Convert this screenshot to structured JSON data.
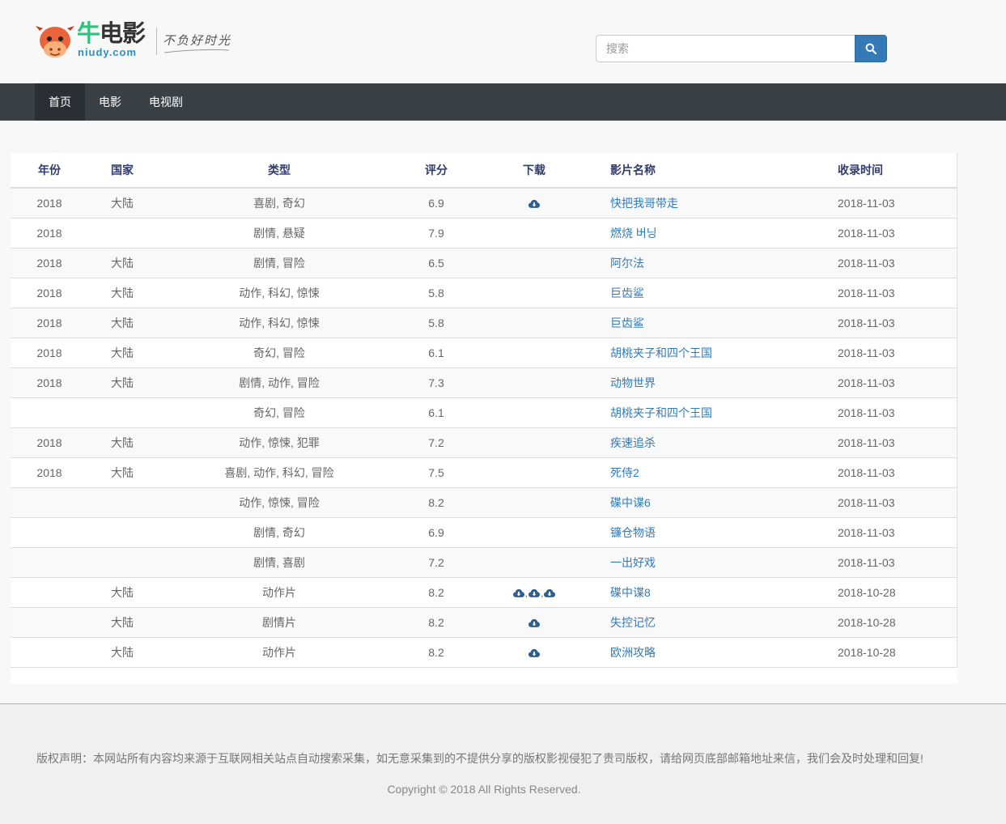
{
  "brand": {
    "name_part1": "牛",
    "name_part2": "电影",
    "domain": "niudy.com",
    "slogan": "不负好时光"
  },
  "search": {
    "placeholder": "搜索",
    "button_icon": "search-icon"
  },
  "nav": {
    "items": [
      {
        "label": "首页",
        "active": true
      },
      {
        "label": "电影",
        "active": false
      },
      {
        "label": "电视剧",
        "active": false
      }
    ]
  },
  "table": {
    "headers": {
      "year": "年份",
      "country": "国家",
      "type": "类型",
      "score": "评分",
      "download": "下载",
      "name": "影片名称",
      "date": "收录时间"
    },
    "rows": [
      {
        "year": "2018",
        "country": "大陆",
        "type": "喜剧, 奇幻",
        "score": "6.9",
        "downloads": 1,
        "name": "快把我哥带走",
        "date": "2018-11-03"
      },
      {
        "year": "2018",
        "country": "",
        "type": "剧情, 悬疑",
        "score": "7.9",
        "downloads": 0,
        "name": "燃烧 버닝",
        "date": "2018-11-03"
      },
      {
        "year": "2018",
        "country": "大陆",
        "type": "剧情, 冒险",
        "score": "6.5",
        "downloads": 0,
        "name": "阿尔法",
        "date": "2018-11-03"
      },
      {
        "year": "2018",
        "country": "大陆",
        "type": "动作, 科幻, 惊悚",
        "score": "5.8",
        "downloads": 0,
        "name": "巨齿鲨",
        "date": "2018-11-03"
      },
      {
        "year": "2018",
        "country": "大陆",
        "type": "动作, 科幻, 惊悚",
        "score": "5.8",
        "downloads": 0,
        "name": "巨齿鲨",
        "date": "2018-11-03"
      },
      {
        "year": "2018",
        "country": "大陆",
        "type": "奇幻, 冒险",
        "score": "6.1",
        "downloads": 0,
        "name": "胡桃夹子和四个王国",
        "date": "2018-11-03"
      },
      {
        "year": "2018",
        "country": "大陆",
        "type": "剧情, 动作, 冒险",
        "score": "7.3",
        "downloads": 0,
        "name": "动物世界",
        "date": "2018-11-03"
      },
      {
        "year": "",
        "country": "",
        "type": "奇幻, 冒险",
        "score": "6.1",
        "downloads": 0,
        "name": "胡桃夹子和四个王国",
        "date": "2018-11-03"
      },
      {
        "year": "2018",
        "country": "大陆",
        "type": "动作, 惊悚, 犯罪",
        "score": "7.2",
        "downloads": 0,
        "name": "疾速追杀",
        "date": "2018-11-03"
      },
      {
        "year": "2018",
        "country": "大陆",
        "type": "喜剧, 动作, 科幻, 冒险",
        "score": "7.5",
        "downloads": 0,
        "name": "死侍2",
        "date": "2018-11-03"
      },
      {
        "year": "",
        "country": "",
        "type": "动作, 惊悚, 冒险",
        "score": "8.2",
        "downloads": 0,
        "name": "碟中谍6",
        "date": "2018-11-03"
      },
      {
        "year": "",
        "country": "",
        "type": "剧情, 奇幻",
        "score": "6.9",
        "downloads": 0,
        "name": "镰仓物语",
        "date": "2018-11-03"
      },
      {
        "year": "",
        "country": "",
        "type": "剧情, 喜剧",
        "score": "7.2",
        "downloads": 0,
        "name": "一出好戏",
        "date": "2018-11-03"
      },
      {
        "year": "",
        "country": "大陆",
        "type": "动作片",
        "score": "8.2",
        "downloads": 3,
        "name": "碟中谍8",
        "date": "2018-10-28"
      },
      {
        "year": "",
        "country": "大陆",
        "type": "剧情片",
        "score": "8.2",
        "downloads": 1,
        "name": "失控记忆",
        "date": "2018-10-28"
      },
      {
        "year": "",
        "country": "大陆",
        "type": "动作片",
        "score": "8.2",
        "downloads": 1,
        "name": "欧洲攻略",
        "date": "2018-10-28"
      }
    ],
    "download_icon": "cloud-download-icon",
    "download_separator": ","
  },
  "footer": {
    "notice": "版权声明：本网站所有内容均来源于互联网相关站点自动搜索采集，如无意采集到的不提供分享的版权影视侵犯了贵司版权，请给网页底部邮箱地址来信，我们会及时处理和回复!",
    "copyright": "Copyright © 2018 All Rights Reserved."
  },
  "colors": {
    "accent": "#337ab7",
    "nav_bg": "#3b4045",
    "nav_active_bg": "#2b2f33",
    "brand_green": "#2ec27e",
    "footer_border": "#7fd1b1"
  }
}
